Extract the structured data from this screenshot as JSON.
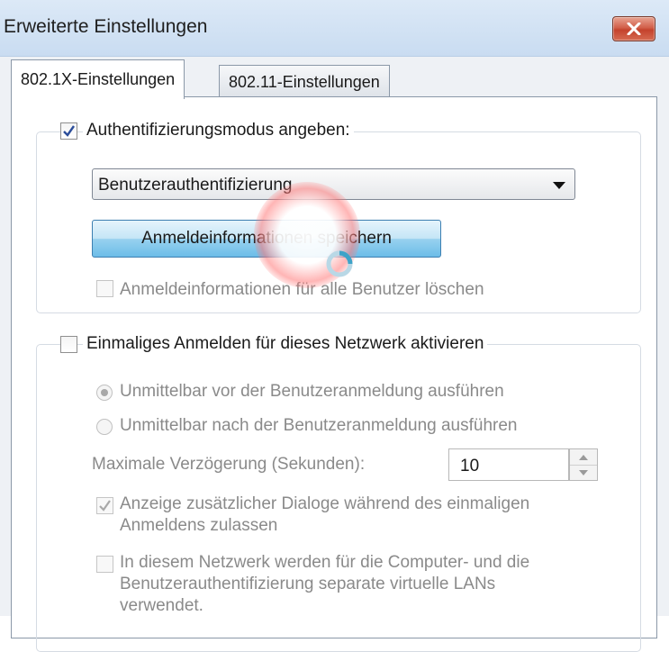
{
  "window": {
    "title": "Erweiterte Einstellungen",
    "close_icon": "close-x-icon"
  },
  "tabs": [
    {
      "label": "802.1X-Einstellungen",
      "active": true
    },
    {
      "label": "802.11-Einstellungen",
      "active": false
    }
  ],
  "auth_group": {
    "specify_mode_label": "Authentifizierungsmodus angeben:",
    "specify_mode_checked": true,
    "mode_selected": "Benutzerauthentifizierung",
    "save_credentials_label": "Anmeldeinformationen speichern",
    "delete_credentials_label": "Anmeldeinformationen für alle Benutzer löschen",
    "delete_credentials_checked": false
  },
  "sso_group": {
    "enable_label": "Einmaliges Anmelden für dieses Netzwerk aktivieren",
    "enable_checked": false,
    "radio_before": "Unmittelbar vor der Benutzeranmeldung ausführen",
    "radio_after": "Unmittelbar nach der Benutzeranmeldung ausführen",
    "radio_selected": "before",
    "max_delay_label": "Maximale Verzögerung (Sekunden):",
    "max_delay_value": "10",
    "allow_dialogs_line1": "Anzeige zusätzlicher Dialoge während des einmaligen",
    "allow_dialogs_line2": "Anmeldens zulassen",
    "allow_dialogs_checked": true,
    "separate_vlans_line1": "In diesem Netzwerk werden für die Computer- und die",
    "separate_vlans_line2": "Benutzerauthentifizierung separate virtuelle LANs",
    "separate_vlans_line3": "verwendet.",
    "separate_vlans_checked": false
  },
  "colors": {
    "titlebar": "#c9dcf1",
    "close_button": "#c4432d",
    "primary_button": "#98d1ef",
    "checkmark": "#2b4d9a"
  }
}
